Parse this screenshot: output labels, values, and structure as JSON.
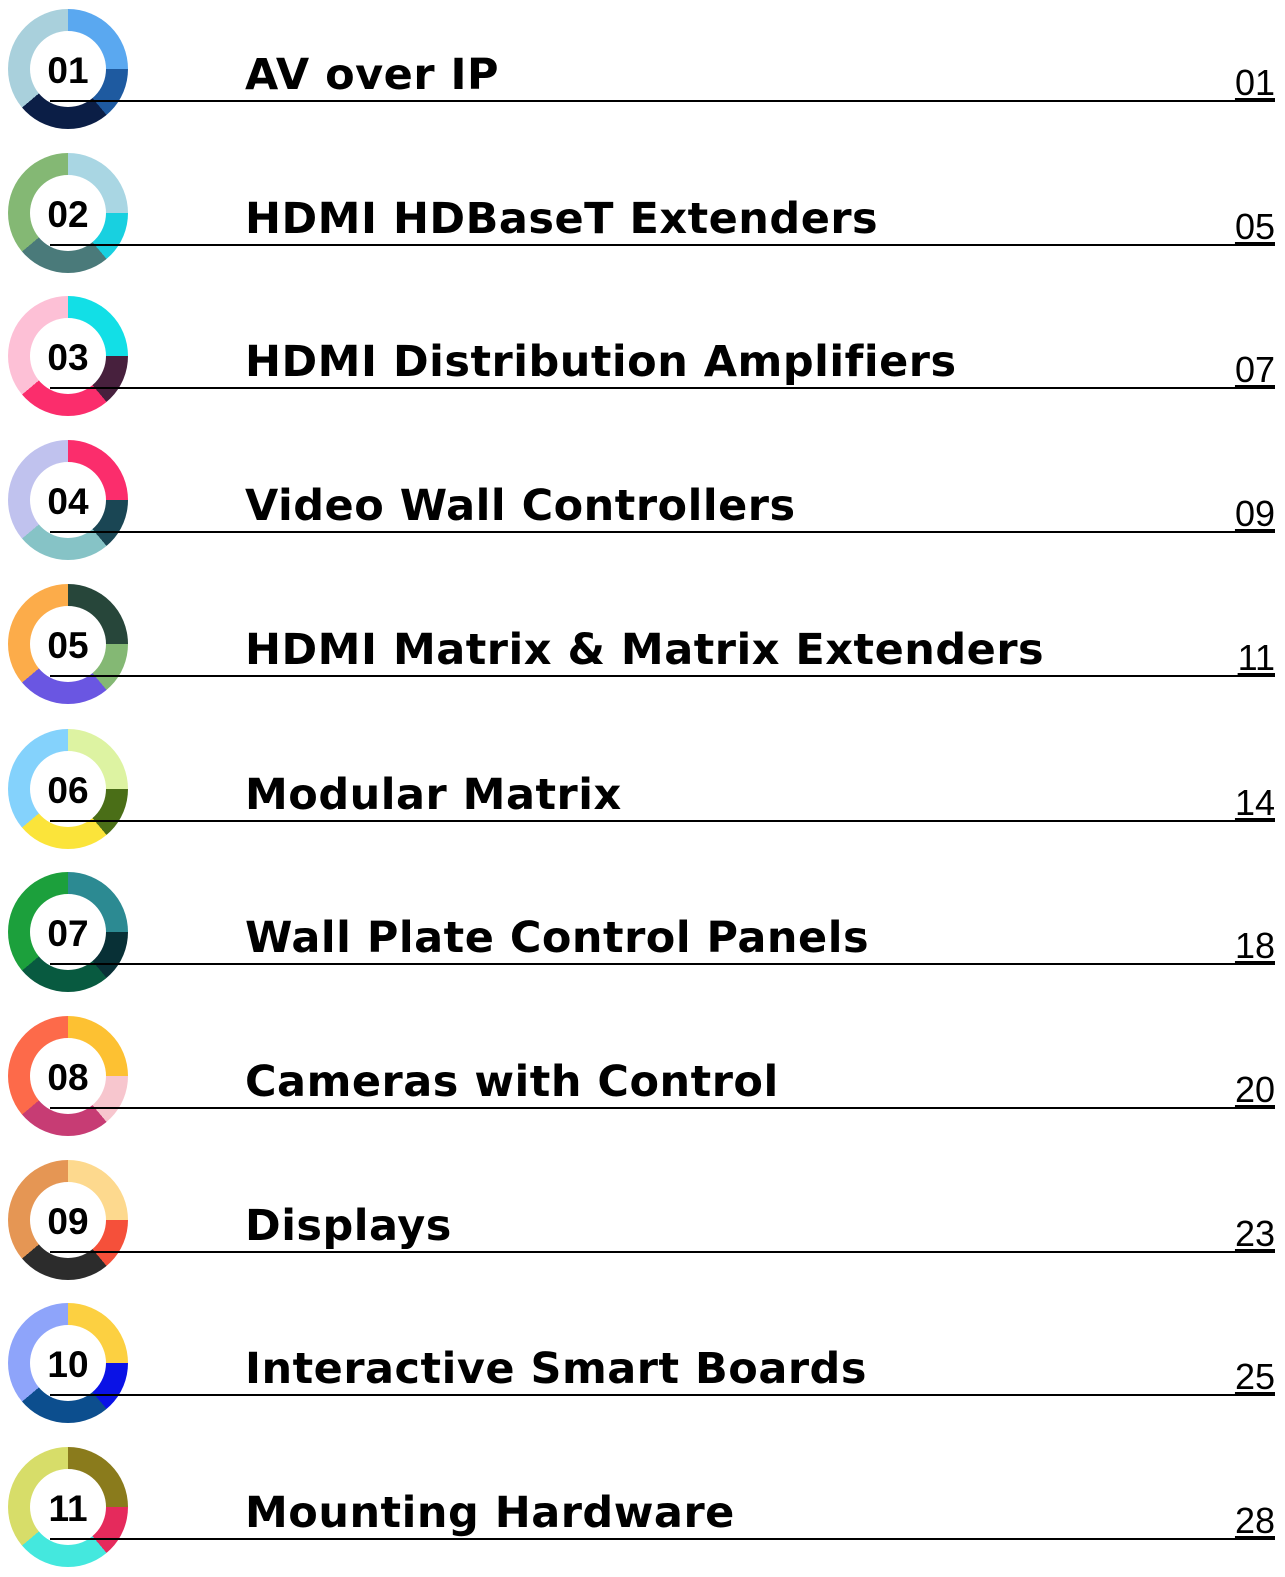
{
  "entries": [
    {
      "number": "01",
      "title": "AV over IP",
      "page": "01",
      "ring_colors": [
        "#5aa8f0",
        "#1e5aa0",
        "#0b1e46",
        "#a9d0dc"
      ]
    },
    {
      "number": "02",
      "title": "HDMI HDBaseT Extenders",
      "page": "05",
      "ring_colors": [
        "#a9d6e3",
        "#18d0e0",
        "#4a7a7a",
        "#84b874"
      ]
    },
    {
      "number": "03",
      "title": "HDMI Distribution Amplifiers",
      "page": "07",
      "ring_colors": [
        "#12dfe6",
        "#47203d",
        "#fb2d6c",
        "#fdc0d6"
      ]
    },
    {
      "number": "04",
      "title": "Video Wall Controllers",
      "page": "09",
      "ring_colors": [
        "#fb2d6c",
        "#1a4654",
        "#86c3c6",
        "#c0c2ee"
      ]
    },
    {
      "number": "05",
      "title": "HDMI Matrix & Matrix Extenders",
      "page": "11",
      "ring_colors": [
        "#27463a",
        "#84b874",
        "#6a56e2",
        "#fcac4a"
      ]
    },
    {
      "number": "06",
      "title": "Modular Matrix",
      "page": "14",
      "ring_colors": [
        "#ddf3a2",
        "#4a6e17",
        "#fbe43a",
        "#84d2fc"
      ]
    },
    {
      "number": "07",
      "title": "Wall Plate Control Panels",
      "page": "18",
      "ring_colors": [
        "#2c8a92",
        "#083036",
        "#085a40",
        "#1ca03c"
      ]
    },
    {
      "number": "08",
      "title": "Cameras with Control",
      "page": "20",
      "ring_colors": [
        "#fdc132",
        "#f7c6ce",
        "#c73c74",
        "#fd6a4a"
      ]
    },
    {
      "number": "09",
      "title": "Displays",
      "page": "23",
      "ring_colors": [
        "#fdd98e",
        "#f5503a",
        "#2c2c2c",
        "#e59654"
      ]
    },
    {
      "number": "10",
      "title": "Interactive Smart Boards",
      "page": "25",
      "ring_colors": [
        "#fcd041",
        "#0a12e6",
        "#0c4e8e",
        "#8ea4fa"
      ]
    },
    {
      "number": "11",
      "title": "Mounting Hardware",
      "page": "28",
      "ring_colors": [
        "#8a7b1c",
        "#e52a5c",
        "#44e8de",
        "#d7dd69"
      ]
    }
  ]
}
